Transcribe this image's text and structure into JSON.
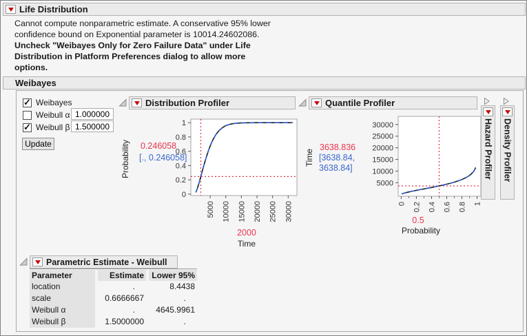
{
  "life_distribution": {
    "title": "Life Distribution",
    "message_lines": [
      "Cannot compute nonparametric estimate. A conservative 95% lower",
      "confidence bound on Exponential parameter is 10014.24602086."
    ],
    "warning_lines": [
      "Uncheck \"Weibayes Only for Zero Failure Data\" under Life",
      "Distribution in Platform Preferences dialog to allow more",
      "options."
    ]
  },
  "weibayes": {
    "title": "Weibayes",
    "rows": [
      {
        "label": "Weibayes",
        "checked": true,
        "value": null
      },
      {
        "label": "Weibull α",
        "checked": false,
        "value": "1.000000"
      },
      {
        "label": "Weibull β",
        "checked": true,
        "value": "1.500000"
      }
    ],
    "update_label": "Update"
  },
  "chart_data": [
    {
      "type": "line",
      "title": "Distribution Profiler",
      "xlabel": "Time",
      "ylabel": "Probability",
      "xlim": [
        -1200,
        32800
      ],
      "ylim": [
        -0.02,
        1.05
      ],
      "xticks": [
        5000,
        10000,
        15000,
        20000,
        25000,
        30000
      ],
      "xtick_labels": [
        "5000",
        "10000",
        "15000",
        "20000",
        "25000",
        "30000"
      ],
      "yticks": [
        0,
        0.2,
        0.4,
        0.6,
        0.8,
        1
      ],
      "ytick_labels": [
        "0",
        "0.2",
        "0.4",
        "0.6",
        "0.8",
        "1"
      ],
      "crosshair": {
        "x": 2000,
        "y": 0.246058
      },
      "current_value": "0.246058",
      "interval_lines": [
        "[., 0.246058]"
      ],
      "current_x": "2000",
      "colors": {
        "crosshair": "#e03040",
        "bound": "#1a1a1a",
        "estimate": "#2b5fd9"
      },
      "series": [
        {
          "name": "bound",
          "color": "#1a1a1a",
          "dash": "",
          "points": [
            [
              400,
              0.024
            ],
            [
              800,
              0.068
            ],
            [
              1200,
              0.122
            ],
            [
              1600,
              0.182
            ],
            [
              2000,
              0.246
            ],
            [
              2400,
              0.31
            ],
            [
              2800,
              0.373
            ],
            [
              3200,
              0.434
            ],
            [
              3600,
              0.493
            ],
            [
              4000,
              0.55
            ],
            [
              4500,
              0.615
            ],
            [
              5000,
              0.673
            ],
            [
              5500,
              0.724
            ],
            [
              6000,
              0.77
            ],
            [
              6500,
              0.809
            ],
            [
              7000,
              0.843
            ],
            [
              7500,
              0.871
            ],
            [
              8000,
              0.896
            ],
            [
              9000,
              0.932
            ],
            [
              10000,
              0.958
            ],
            [
              11000,
              0.974
            ],
            [
              12000,
              0.984
            ],
            [
              13000,
              0.99
            ],
            [
              14000,
              0.994
            ],
            [
              15000,
              0.997
            ],
            [
              17000,
              0.999
            ],
            [
              20000,
              1.0
            ],
            [
              24000,
              1.0
            ],
            [
              28000,
              1.0
            ],
            [
              31500,
              1.0
            ]
          ]
        },
        {
          "name": "estimate",
          "color": "#2b5fd9",
          "dash": "7 5",
          "points": [
            [
              400,
              0.024
            ],
            [
              800,
              0.068
            ],
            [
              1200,
              0.122
            ],
            [
              1600,
              0.182
            ],
            [
              2000,
              0.246
            ],
            [
              2400,
              0.31
            ],
            [
              2800,
              0.373
            ],
            [
              3200,
              0.434
            ],
            [
              3600,
              0.493
            ],
            [
              4000,
              0.55
            ],
            [
              4500,
              0.615
            ],
            [
              5000,
              0.673
            ],
            [
              5500,
              0.724
            ],
            [
              6000,
              0.77
            ],
            [
              6500,
              0.809
            ],
            [
              7000,
              0.843
            ],
            [
              7500,
              0.871
            ],
            [
              8000,
              0.896
            ],
            [
              9000,
              0.932
            ],
            [
              10000,
              0.958
            ],
            [
              11000,
              0.974
            ],
            [
              12000,
              0.984
            ],
            [
              13000,
              0.99
            ],
            [
              14000,
              0.994
            ],
            [
              15000,
              0.997
            ],
            [
              17000,
              0.999
            ],
            [
              20000,
              1.0
            ],
            [
              24000,
              1.0
            ],
            [
              28000,
              1.0
            ],
            [
              31500,
              1.0
            ]
          ]
        }
      ]
    },
    {
      "type": "line",
      "title": "Quantile Profiler",
      "xlabel": "Probability",
      "ylabel": "Time",
      "xlim": [
        -0.04,
        1.05
      ],
      "ylim": [
        -800,
        33500
      ],
      "xticks": [
        0,
        0.2,
        0.4,
        0.6,
        0.8,
        1
      ],
      "xtick_labels": [
        "0",
        "0.2",
        "0.4",
        "0.6",
        "0.8",
        "1"
      ],
      "xminor": [
        0.1,
        0.3,
        0.5,
        0.7,
        0.9
      ],
      "yticks": [
        5000,
        10000,
        15000,
        20000,
        25000,
        30000
      ],
      "ytick_labels": [
        "5000",
        "10000",
        "15000",
        "20000",
        "25000",
        "30000"
      ],
      "crosshair": {
        "x": 0.5,
        "y": 3638.836
      },
      "current_value": "3638.836",
      "interval_lines": [
        "[3638.84,",
        "3638.84]"
      ],
      "current_x": "0.5",
      "colors": {
        "crosshair": "#e03040",
        "bound": "#1a1a1a",
        "estimate": "#2b5fd9"
      },
      "series": [
        {
          "name": "bound",
          "color": "#1a1a1a",
          "dash": "",
          "points": [
            [
              0.005,
              135
            ],
            [
              0.02,
              340
            ],
            [
              0.05,
              640
            ],
            [
              0.08,
              880
            ],
            [
              0.12,
              1180
            ],
            [
              0.16,
              1460
            ],
            [
              0.2,
              1709
            ],
            [
              0.25,
              2025
            ],
            [
              0.3,
              2338
            ],
            [
              0.35,
              2652
            ],
            [
              0.4,
              2969
            ],
            [
              0.45,
              3297
            ],
            [
              0.5,
              3638
            ],
            [
              0.55,
              3997
            ],
            [
              0.6,
              4383
            ],
            [
              0.65,
              4801
            ],
            [
              0.7,
              5258
            ],
            [
              0.75,
              5775
            ],
            [
              0.8,
              6383
            ],
            [
              0.84,
              6980
            ],
            [
              0.88,
              7700
            ],
            [
              0.91,
              8360
            ],
            [
              0.94,
              9250
            ],
            [
              0.96,
              10050
            ],
            [
              0.975,
              11000
            ],
            [
              0.98,
              11536
            ]
          ]
        },
        {
          "name": "estimate",
          "color": "#2b5fd9",
          "dash": "7 5",
          "points": [
            [
              0.005,
              135
            ],
            [
              0.02,
              340
            ],
            [
              0.05,
              640
            ],
            [
              0.08,
              880
            ],
            [
              0.12,
              1180
            ],
            [
              0.16,
              1460
            ],
            [
              0.2,
              1709
            ],
            [
              0.25,
              2025
            ],
            [
              0.3,
              2338
            ],
            [
              0.35,
              2652
            ],
            [
              0.4,
              2969
            ],
            [
              0.45,
              3297
            ],
            [
              0.5,
              3638
            ],
            [
              0.55,
              3997
            ],
            [
              0.6,
              4383
            ],
            [
              0.65,
              4801
            ],
            [
              0.7,
              5258
            ],
            [
              0.75,
              5775
            ],
            [
              0.8,
              6383
            ],
            [
              0.84,
              6980
            ],
            [
              0.88,
              7700
            ],
            [
              0.91,
              8360
            ],
            [
              0.94,
              9250
            ],
            [
              0.96,
              10050
            ],
            [
              0.975,
              11000
            ],
            [
              0.98,
              11536
            ]
          ]
        }
      ]
    }
  ],
  "collapsed_panels": [
    {
      "title": "Hazard Profiler"
    },
    {
      "title": "Density Profiler"
    }
  ],
  "parametric_estimate": {
    "title": "Parametric Estimate - Weibull",
    "columns": [
      "Parameter",
      "Estimate",
      "Lower 95%"
    ],
    "rows": [
      [
        "location",
        ".",
        "8.4438"
      ],
      [
        "scale",
        "0.6666667",
        "."
      ],
      [
        "Weibull α",
        ".",
        "4645.9961"
      ],
      [
        "Weibull β",
        "1.5000000",
        "."
      ]
    ]
  }
}
